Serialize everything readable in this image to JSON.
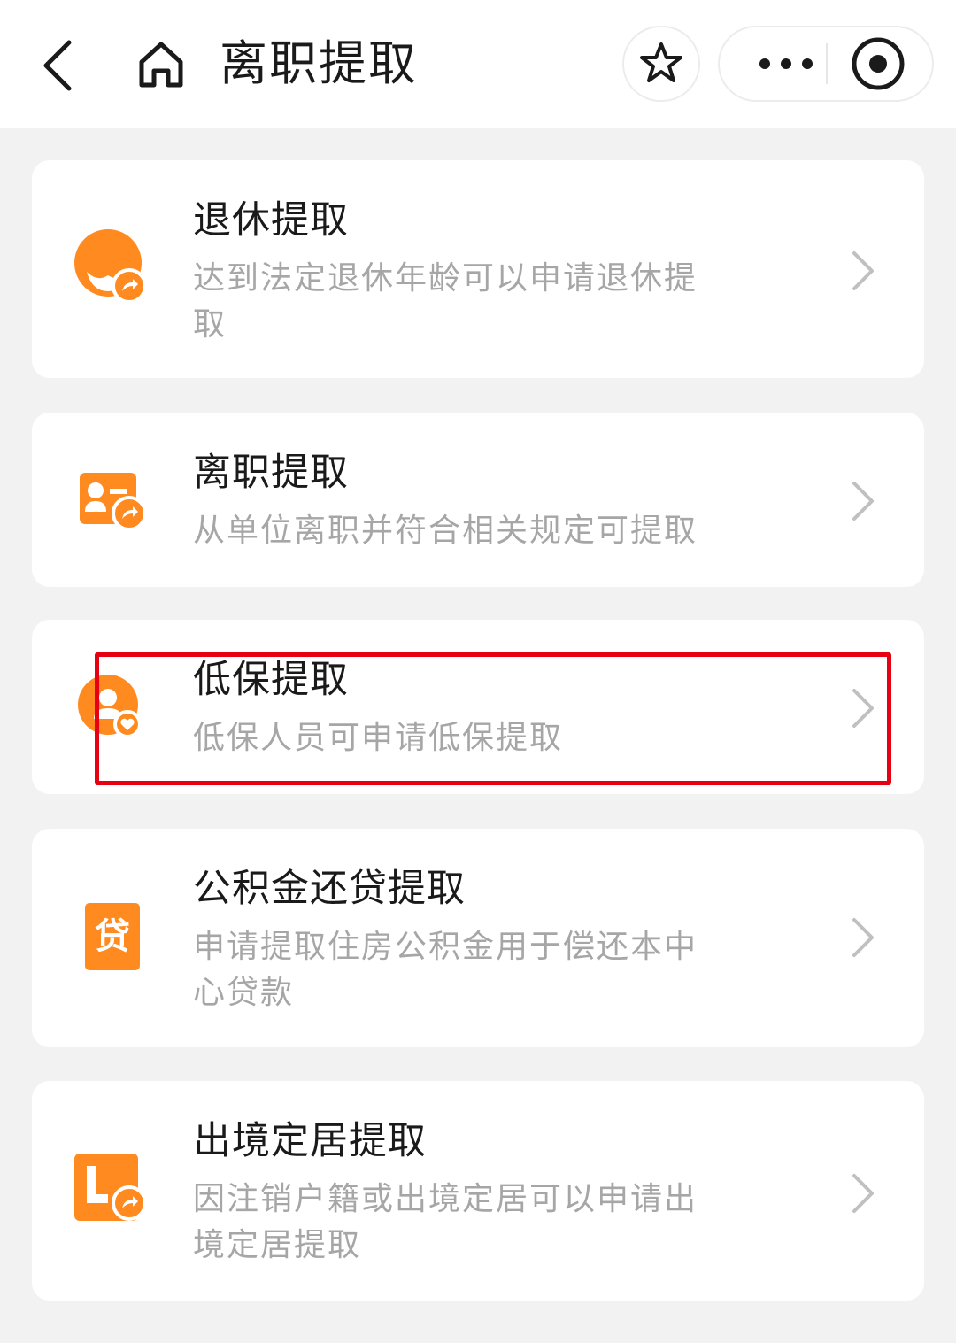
{
  "header": {
    "title": "离职提取",
    "back_icon": "back-arrow-icon",
    "home_icon": "home-icon",
    "star_icon": "star-icon",
    "more_icon": "more-dots-icon",
    "close_icon": "target-circle-icon"
  },
  "items": [
    {
      "title": "退休提取",
      "desc": "达到法定退休年龄可以申请退休提取",
      "icon": "retirement-icon"
    },
    {
      "title": "离职提取",
      "desc": "从单位离职并符合相关规定可提取",
      "icon": "resignation-icon"
    },
    {
      "title": "低保提取",
      "desc": "低保人员可申请低保提取",
      "icon": "low-income-icon"
    },
    {
      "title": "公积金还贷提取",
      "desc": "申请提取住房公积金用于偿还本中心贷款",
      "icon": "loan-icon",
      "icon_text": "贷"
    },
    {
      "title": "出境定居提取",
      "desc": "因注销户籍或出境定居可以申请出境定居提取",
      "icon": "emigration-icon"
    }
  ],
  "colors": {
    "accent": "#ff8a1f",
    "highlight": "#e60012",
    "background": "#f2f2f2",
    "desc_text": "#a6a6a6"
  }
}
